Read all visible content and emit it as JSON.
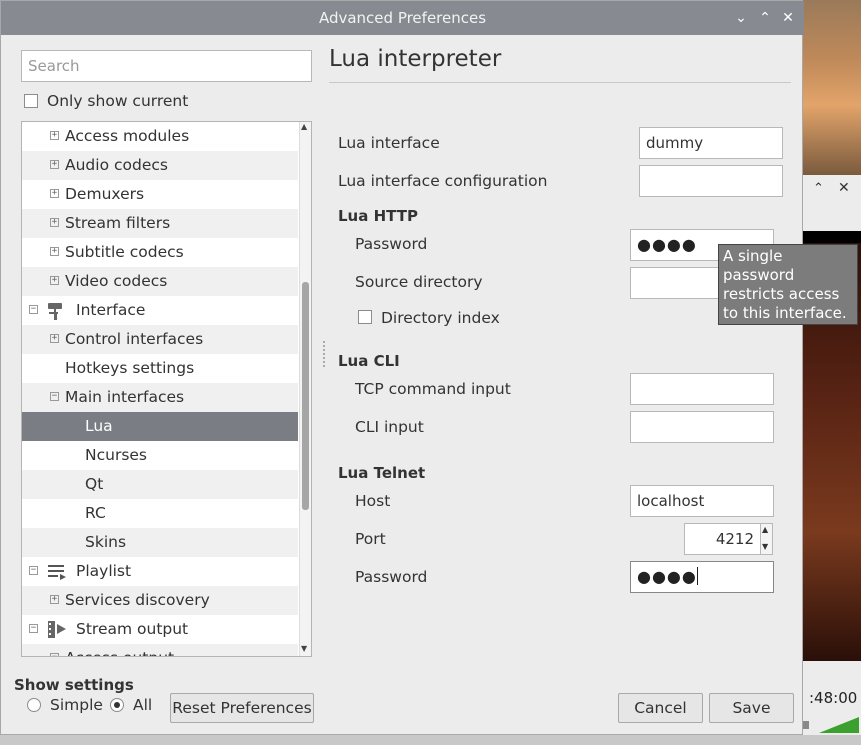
{
  "dialog": {
    "title": "Advanced Preferences",
    "title_buttons": [
      "minimize-icon",
      "maximize-icon",
      "close-icon"
    ]
  },
  "search": {
    "placeholder": "Search",
    "value": ""
  },
  "only_show_current": {
    "label": "Only show current",
    "checked": false
  },
  "tree": {
    "items": [
      {
        "label": "Access modules",
        "expander": "+",
        "icon": ""
      },
      {
        "label": "Audio codecs",
        "expander": "+",
        "icon": ""
      },
      {
        "label": "Demuxers",
        "expander": "+",
        "icon": ""
      },
      {
        "label": "Stream filters",
        "expander": "+",
        "icon": ""
      },
      {
        "label": "Subtitle codecs",
        "expander": "+",
        "icon": ""
      },
      {
        "label": "Video codecs",
        "expander": "+",
        "icon": ""
      },
      {
        "label": "Interface",
        "expander": "−",
        "icon": "paint-roller-icon"
      },
      {
        "label": "Control interfaces",
        "expander": "+",
        "icon": ""
      },
      {
        "label": "Hotkeys settings",
        "expander": "",
        "icon": ""
      },
      {
        "label": "Main interfaces",
        "expander": "−",
        "icon": ""
      },
      {
        "label": "Lua",
        "expander": "",
        "icon": "",
        "selected": true
      },
      {
        "label": "Ncurses",
        "expander": "",
        "icon": ""
      },
      {
        "label": "Qt",
        "expander": "",
        "icon": ""
      },
      {
        "label": "RC",
        "expander": "",
        "icon": ""
      },
      {
        "label": "Skins",
        "expander": "",
        "icon": ""
      },
      {
        "label": "Playlist",
        "expander": "−",
        "icon": "playlist-icon"
      },
      {
        "label": "Services discovery",
        "expander": "+",
        "icon": ""
      },
      {
        "label": "Stream output",
        "expander": "−",
        "icon": "stream-output-icon"
      },
      {
        "label": "Access output",
        "expander": "−",
        "icon": ""
      }
    ]
  },
  "panel": {
    "heading": "Lua interpreter",
    "lua_interface": {
      "label": "Lua interface",
      "value": "dummy"
    },
    "lua_interface_config": {
      "label": "Lua interface configuration",
      "value": ""
    },
    "lua_http": {
      "heading": "Lua HTTP",
      "password": {
        "label": "Password",
        "value": "●●●●"
      },
      "source_directory": {
        "label": "Source directory",
        "value": ""
      },
      "directory_index": {
        "label": "Directory index",
        "checked": false
      }
    },
    "lua_cli": {
      "heading": "Lua CLI",
      "tcp_command_input": {
        "label": "TCP command input",
        "value": ""
      },
      "cli_input": {
        "label": "CLI input",
        "value": ""
      }
    },
    "lua_telnet": {
      "heading": "Lua Telnet",
      "host": {
        "label": "Host",
        "value": "localhost"
      },
      "port": {
        "label": "Port",
        "value": "4212"
      },
      "password": {
        "label": "Password",
        "value": "●●●●"
      }
    }
  },
  "tooltip": {
    "text": "A single password restricts access to this interface."
  },
  "show_settings": {
    "label": "Show settings",
    "options": [
      {
        "label": "Simple",
        "selected": false
      },
      {
        "label": "All",
        "selected": true
      }
    ]
  },
  "buttons": {
    "reset": "Reset Preferences",
    "cancel": "Cancel",
    "save": "Save"
  },
  "background_window": {
    "time": ":48:00"
  }
}
